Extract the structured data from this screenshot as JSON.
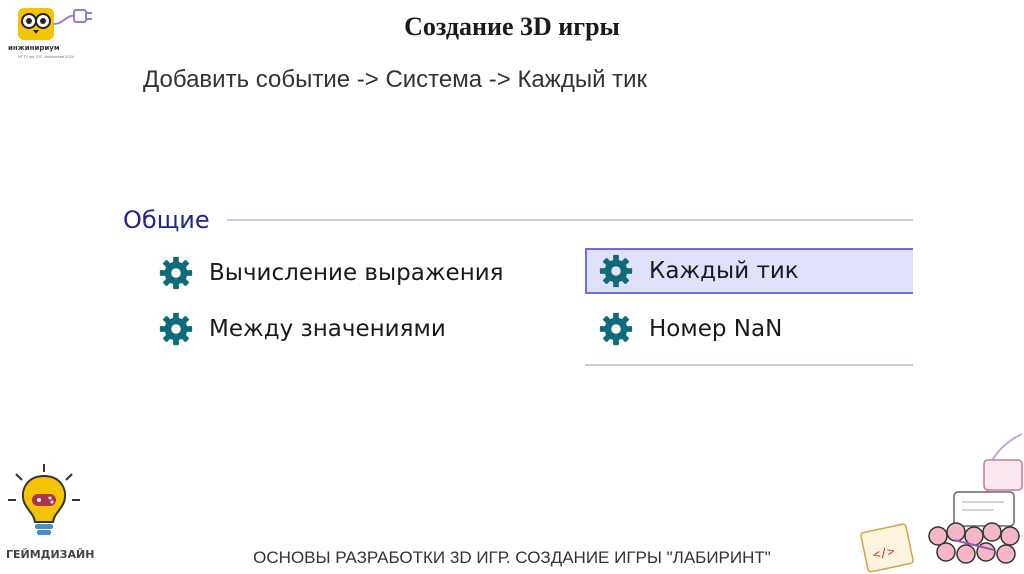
{
  "slide": {
    "title": "Создание 3D игры",
    "subtitle": "Добавить событие -> Система -> Каждый тик",
    "footer": "ОСНОВЫ РАЗРАБОТКИ 3D ИГР. СОЗДАНИЕ ИГРЫ \"ЛАБИРИНТ\""
  },
  "logo_top": {
    "name": "инжинириум",
    "tagline": "НГТУ им. Р.Е. Алексеева 2024"
  },
  "logo_bottom": {
    "name": "ГЕЙМДИЗАЙН"
  },
  "panel": {
    "section_title": "Общие",
    "items": [
      {
        "label": "Вычисление выражения",
        "icon": "gear-icon",
        "selected": false
      },
      {
        "label": "Каждый тик",
        "icon": "gear-icon",
        "selected": true
      },
      {
        "label": "Между значениями",
        "icon": "gear-icon",
        "selected": false
      },
      {
        "label": "Номер NaN",
        "icon": "gear-icon",
        "selected": false
      }
    ]
  },
  "colors": {
    "accent": "#23238e",
    "gear": "#0f6b78",
    "selection_bg": "#e0e0fa",
    "selection_border": "#6f6fd6"
  }
}
